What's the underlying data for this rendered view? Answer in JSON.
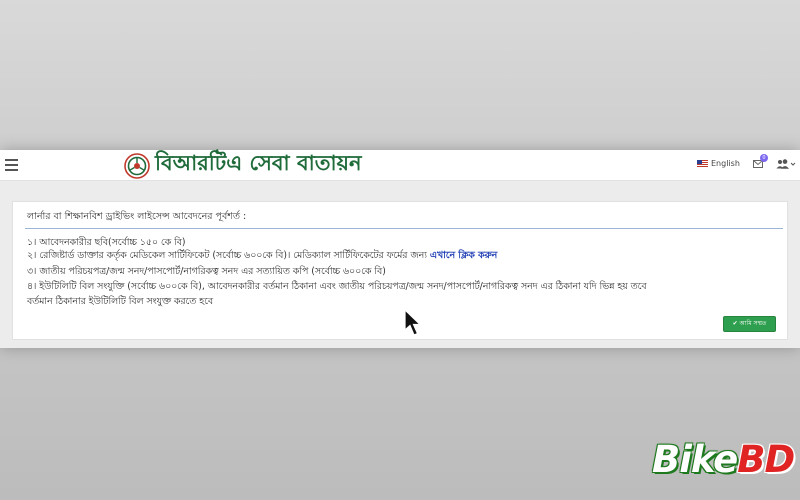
{
  "header": {
    "site_title": "বিআরটিএ সেবা বাতায়ন",
    "language_label": "English",
    "notification_count": "0"
  },
  "card": {
    "title": "লার্নার বা শিক্ষানবিশ ড্রাইভিং লাইসেন্স আবেদনের পূর্বশর্ত :",
    "requirements": {
      "r1": "১। আবেদনকারীর ছবি(সর্বোচ্চ ১৫০ কে বি)",
      "r2_text": "২। রেজিষ্টার্ড ডাক্তার কর্তৃক মেডিকেল সার্টিফিকেট (সর্বোচ্চ ৬০০কে বি)। মেডিক্যাল সার্টিফিকেটের ফর্মের জন্য ",
      "r2_link": "এখানে ক্লিক করুন",
      "r3": "৩। জাতীয় পরিচয়পত্র/জন্ম সনদ/পাসপোর্ট/নাগরিকত্ব সনদ এর সত্যায়িত কপি (সর্বোচ্চ ৬০০কে বি)",
      "r4_line1": "৪। ইউটিলিটি বিল সংযুক্তি (সর্বোচ্চ ৬০০কে বি), আবেদনকারীর বর্তমান ঠিকানা এবং জাতীয় পরিচয়পত্র/জন্ম সনদ/পাসপোর্ট/নাগরিকত্ব সনদ এর ঠিকানা যদি ভিন্ন হয় তবে",
      "r4_line2": "বর্তমান ঠিকানার ইউটিলিটি বিল সংযুক্ত করতে হবে"
    },
    "agree_button_label": "✔ আমি সম্মত"
  },
  "watermark": {
    "part1": "Bike",
    "part2": "BD"
  },
  "colors": {
    "brand_green": "#1f6b3a",
    "link_blue": "#1f3fb5",
    "button_green": "#2e9e4f",
    "watermark_red": "#e02424"
  },
  "icons": {
    "menu": "hamburger-icon",
    "logo": "brta-logo-icon",
    "flag": "uk-flag-icon",
    "mail": "mail-icon",
    "users": "users-icon",
    "cursor": "mouse-cursor-icon"
  }
}
